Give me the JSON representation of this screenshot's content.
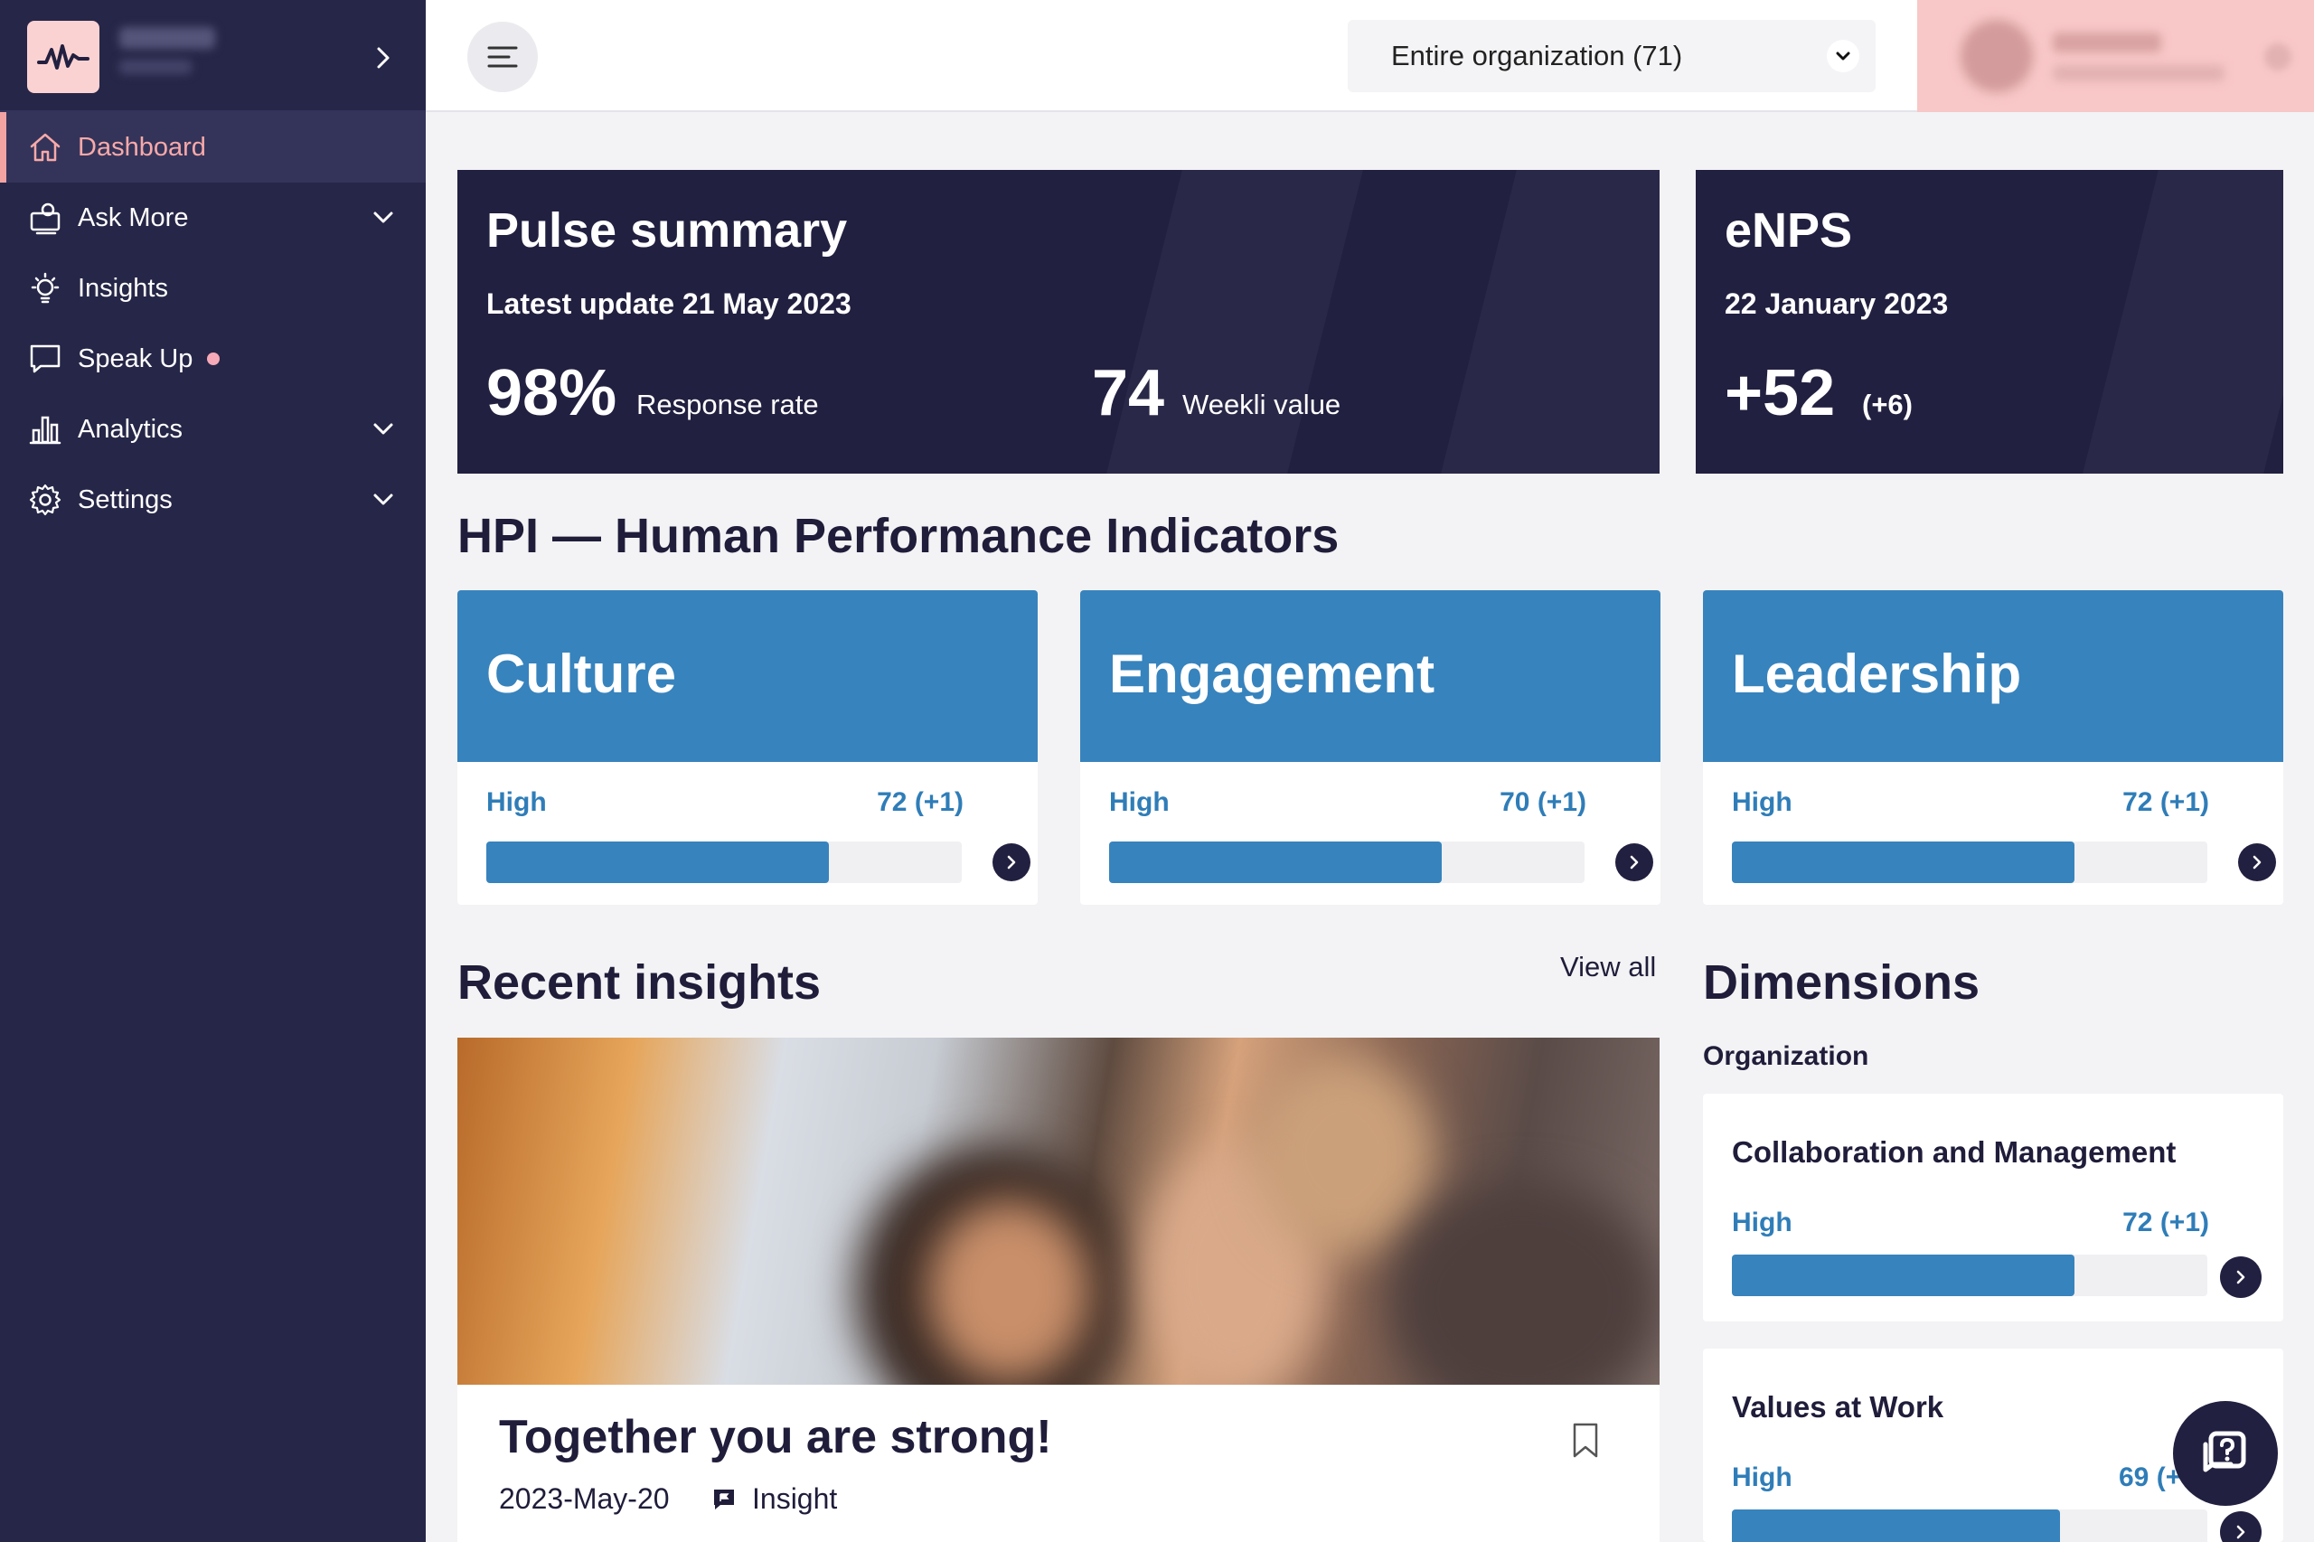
{
  "sidebar": {
    "items": [
      {
        "label": "Dashboard",
        "icon": "home-icon"
      },
      {
        "label": "Ask More",
        "icon": "survey-icon"
      },
      {
        "label": "Insights",
        "icon": "lightbulb-icon"
      },
      {
        "label": "Speak Up",
        "icon": "chat-bubble-icon"
      },
      {
        "label": "Analytics",
        "icon": "bar-chart-icon"
      },
      {
        "label": "Settings",
        "icon": "gear-icon"
      }
    ]
  },
  "topbar": {
    "org_select": "Entire organization (71)"
  },
  "pulse": {
    "title": "Pulse summary",
    "update": "Latest update 21 May 2023",
    "response_value": "98%",
    "response_label": "Response rate",
    "weekli_value": "74",
    "weekli_label": "Weekli value"
  },
  "enps": {
    "title": "eNPS",
    "date": "22 January 2023",
    "value": "+52",
    "delta": "(+6)"
  },
  "hpi": {
    "heading": "HPI — Human Performance Indicators",
    "cards": [
      {
        "title": "Culture",
        "level": "High",
        "score": "72 (+1)",
        "progress": 72
      },
      {
        "title": "Engagement",
        "level": "High",
        "score": "70 (+1)",
        "progress": 70
      },
      {
        "title": "Leadership",
        "level": "High",
        "score": "72 (+1)",
        "progress": 72
      }
    ]
  },
  "insights": {
    "heading": "Recent insights",
    "view_all": "View all",
    "item": {
      "title": "Together you are strong!",
      "date": "2023-May-20",
      "type": "Insight"
    }
  },
  "dimensions": {
    "heading": "Dimensions",
    "subheading": "Organization",
    "items": [
      {
        "title": "Collaboration and Management",
        "level": "High",
        "score": "72 (+1)",
        "progress": 72
      },
      {
        "title": "Values at Work",
        "level": "High",
        "score": "69 (+",
        "progress": 69
      }
    ]
  },
  "colors": {
    "sidebar_bg": "#262648",
    "accent_pink": "#f7a9a9",
    "hpi_blue": "#3783bd",
    "dark_card": "#222040"
  }
}
